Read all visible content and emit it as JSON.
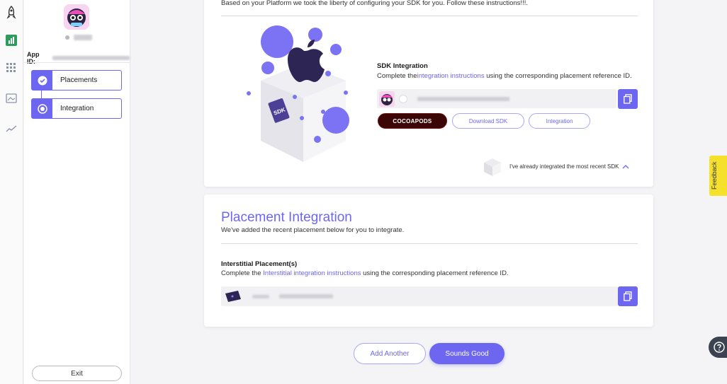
{
  "rail": {
    "icons": [
      "rocket-icon",
      "bar-chart-icon",
      "grid-icon",
      "media-icon",
      "trend-icon"
    ]
  },
  "sidebar": {
    "app_id_label": "App ID:",
    "steps": [
      {
        "label": "Placements",
        "state": "complete"
      },
      {
        "label": "Integration",
        "state": "current"
      }
    ],
    "exit_label": "Exit"
  },
  "sdk_section": {
    "intro": "Based on your Platform we took the liberty of configuring your SDK for you. Follow these instructions!!!.",
    "title": "SDK Integration",
    "desc_before": "Complete the",
    "desc_link": "integration instructions",
    "desc_after": " using the corresponding placement reference ID.",
    "cocoapods_label": "COCOAPODS",
    "download_label": "Download SDK",
    "integration_label": "Integration",
    "already_label": "I've already integrated the most recent SDK"
  },
  "placement_section": {
    "title": "Placement Integration",
    "subtitle": "We've added the recent placement below for you to integrate.",
    "interstitial_title": "Interstitial Placement(s)",
    "desc_before": "Complete the ",
    "desc_link": "Interstitial integration instructions",
    "desc_after": " using the corresponding placement reference ID."
  },
  "footer": {
    "add_another": "Add Another",
    "sounds_good": "Sounds Good"
  },
  "feedback_label": "Feedback",
  "colors": {
    "accent": "#6d66f0",
    "feedback": "#f5e02b",
    "cocoapods": "#3a0606"
  }
}
